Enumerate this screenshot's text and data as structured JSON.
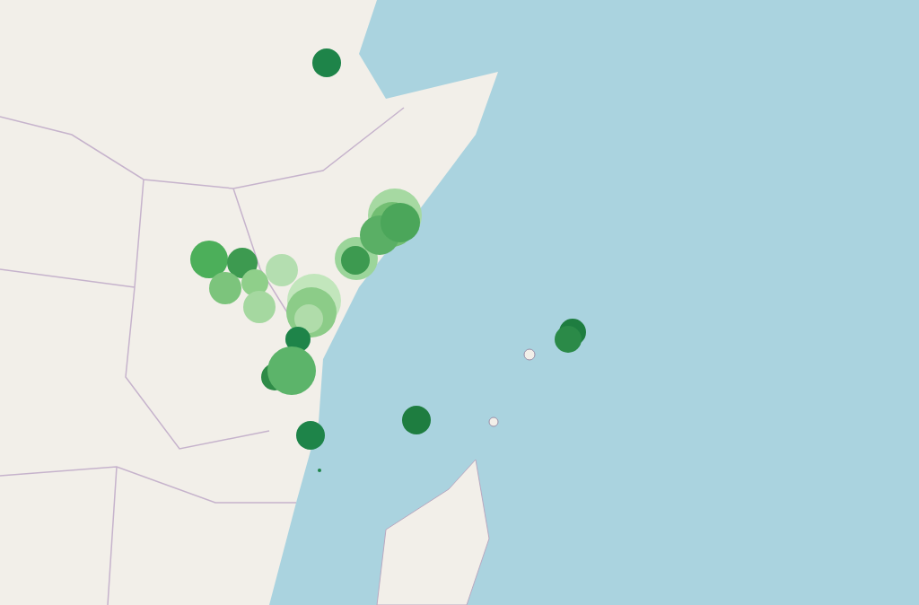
{
  "markers": [
    {
      "color": "#1e8449"
    },
    {
      "color": "#4caf5a"
    },
    {
      "color": "#3d9a50"
    },
    {
      "color": "#b4deb0"
    },
    {
      "color": "#7cc47c"
    },
    {
      "color": "#8fcf8a"
    },
    {
      "color": "#a5d8a0"
    },
    {
      "color": "#c2e6bc"
    },
    {
      "color": "#8ccc88"
    },
    {
      "color": "#b0dcaa"
    },
    {
      "color": "#1e8449"
    },
    {
      "color": "#2e8b47"
    },
    {
      "color": "#5cb46a"
    },
    {
      "color": "#9bd59a"
    },
    {
      "color": "#3d9a50"
    },
    {
      "color": "#a6d9a2"
    },
    {
      "color": "#72be72"
    },
    {
      "color": "#5aaf65"
    },
    {
      "color": "#4ba65a"
    },
    {
      "color": "#1e7d40"
    },
    {
      "color": "#2b8a48"
    },
    {
      "color": "#1e7d40"
    },
    {
      "color": "#1e8449"
    },
    {
      "color": "#1e8449"
    }
  ]
}
